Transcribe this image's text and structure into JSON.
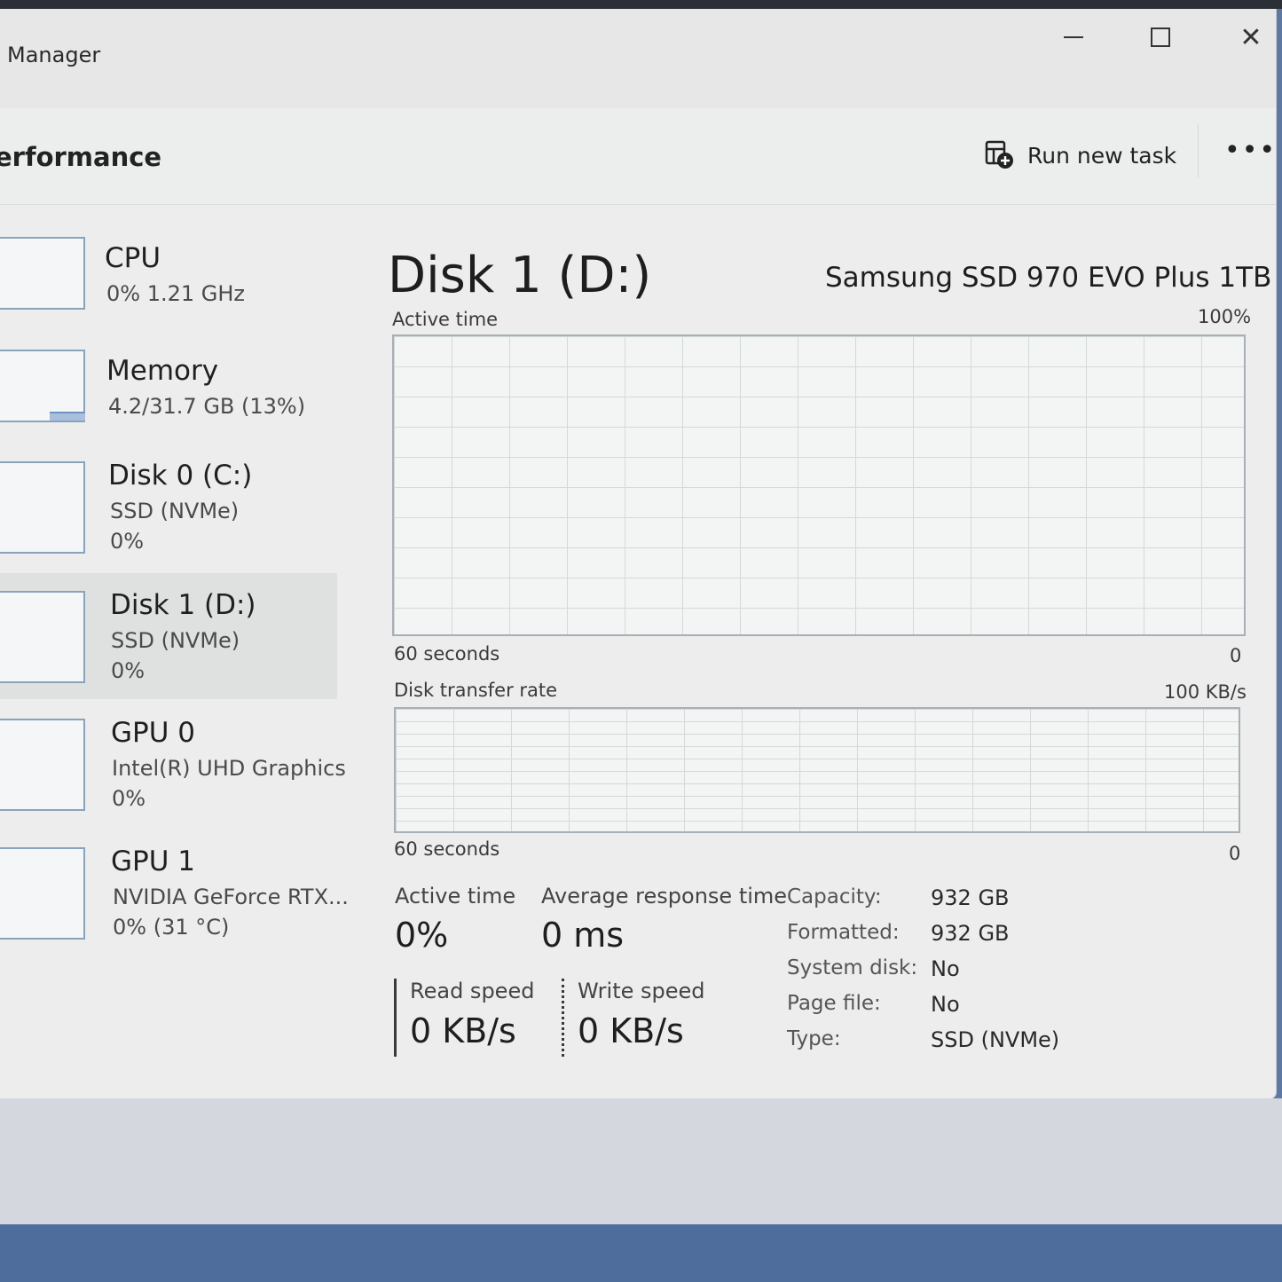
{
  "window": {
    "title": "Manager"
  },
  "header": {
    "page_title": "erformance",
    "run_new_task": "Run new task",
    "more_label": "•••"
  },
  "sidebar": {
    "items": [
      {
        "name": "CPU",
        "line1": "0%  1.21 GHz",
        "line2": ""
      },
      {
        "name": "Memory",
        "line1": "4.2/31.7 GB (13%)",
        "line2": ""
      },
      {
        "name": "Disk 0 (C:)",
        "line1": "SSD (NVMe)",
        "line2": "0%"
      },
      {
        "name": "Disk 1 (D:)",
        "line1": "SSD (NVMe)",
        "line2": "0%"
      },
      {
        "name": "GPU 0",
        "line1": "Intel(R) UHD Graphics",
        "line2": "0%"
      },
      {
        "name": "GPU 1",
        "line1": "NVIDIA GeForce RTX...",
        "line2": "0%  (31 °C)"
      }
    ],
    "selected_index": 3
  },
  "main": {
    "title": "Disk 1 (D:)",
    "model": "Samsung SSD 970 EVO Plus 1TB",
    "active_graph": {
      "label": "Active time",
      "max": "100%",
      "time_label": "60 seconds",
      "min": "0"
    },
    "transfer_graph": {
      "label": "Disk transfer rate",
      "max": "100 KB/s",
      "time_label": "60 seconds",
      "min": "0"
    },
    "stats": {
      "active_time_label": "Active time",
      "active_time_value": "0%",
      "avg_response_label": "Average response time",
      "avg_response_value": "0 ms",
      "read_speed_label": "Read speed",
      "read_speed_value": "0 KB/s",
      "write_speed_label": "Write speed",
      "write_speed_value": "0 KB/s"
    },
    "properties": [
      {
        "label": "Capacity:",
        "value": "932 GB"
      },
      {
        "label": "Formatted:",
        "value": "932 GB"
      },
      {
        "label": "System disk:",
        "value": "No"
      },
      {
        "label": "Page file:",
        "value": "No"
      },
      {
        "label": "Type:",
        "value": "SSD (NVMe)"
      }
    ]
  },
  "colors": {
    "accent": "#6f93c2",
    "graph_border": "#a8b0b7",
    "grid": "#d3dad9"
  }
}
